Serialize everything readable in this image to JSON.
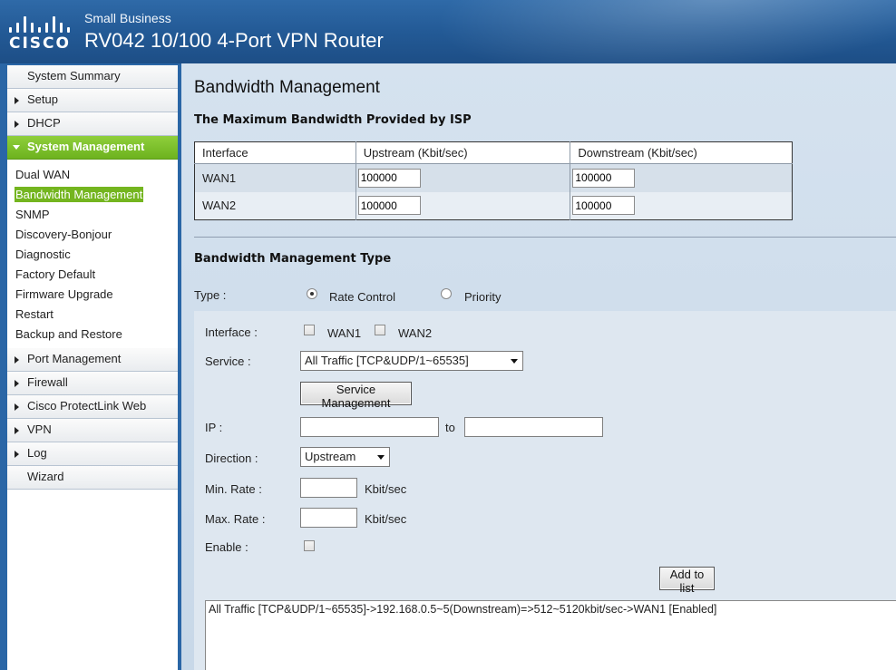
{
  "header": {
    "logo_text": "CISCO",
    "brand_sub": "Small Business",
    "product_title": "RV042  10/100 4-Port VPN Router"
  },
  "sidebar": {
    "items_top": [
      {
        "label": "System Summary",
        "arrow": false
      },
      {
        "label": "Setup",
        "arrow": true
      },
      {
        "label": "DHCP",
        "arrow": true
      }
    ],
    "active": {
      "label": "System Management"
    },
    "sub_items": [
      {
        "label": "Dual WAN"
      },
      {
        "label": "Bandwidth Management",
        "current": true
      },
      {
        "label": "SNMP"
      },
      {
        "label": "Discovery-Bonjour"
      },
      {
        "label": "Diagnostic"
      },
      {
        "label": "Factory Default"
      },
      {
        "label": "Firmware Upgrade"
      },
      {
        "label": "Restart"
      },
      {
        "label": "Backup and Restore"
      }
    ],
    "items_bottom": [
      {
        "label": "Port Management",
        "arrow": true
      },
      {
        "label": "Firewall",
        "arrow": true
      },
      {
        "label": "Cisco ProtectLink Web",
        "arrow": true
      },
      {
        "label": "VPN",
        "arrow": true
      },
      {
        "label": "Log",
        "arrow": true
      },
      {
        "label": "Wizard",
        "arrow": false
      }
    ]
  },
  "main": {
    "page_title": "Bandwidth Management",
    "isp_section_title": "The Maximum Bandwidth Provided by ISP",
    "isp_table": {
      "headers": [
        "Interface",
        "Upstream (Kbit/sec)",
        "Downstream (Kbit/sec)"
      ],
      "rows": [
        {
          "interface": "WAN1",
          "upstream": "100000",
          "downstream": "100000"
        },
        {
          "interface": "WAN2",
          "upstream": "100000",
          "downstream": "100000"
        }
      ]
    },
    "type_section_title": "Bandwidth Management Type",
    "type": {
      "label": "Type :",
      "option_rate": "Rate Control",
      "option_priority": "Priority",
      "selected": "Rate Control"
    },
    "form": {
      "interface_label": "Interface :",
      "wan1": "WAN1",
      "wan2": "WAN2",
      "service_label": "Service :",
      "service_value": "All Traffic [TCP&UDP/1~65535]",
      "service_mgmt_button": "Service Management",
      "ip_label": "IP :",
      "ip_to": "to",
      "ip_from_value": "",
      "ip_to_value": "",
      "direction_label": "Direction :",
      "direction_value": "Upstream",
      "min_rate_label": "Min. Rate :",
      "max_rate_label": "Max. Rate :",
      "rate_unit": "Kbit/sec",
      "min_rate_value": "",
      "max_rate_value": "",
      "enable_label": "Enable :",
      "add_button": "Add to list"
    },
    "rules_list": [
      "All Traffic [TCP&UDP/1~65535]->192.168.0.5~5(Downstream)=>512~5120kbit/sec->WAN1 [Enabled]"
    ]
  }
}
